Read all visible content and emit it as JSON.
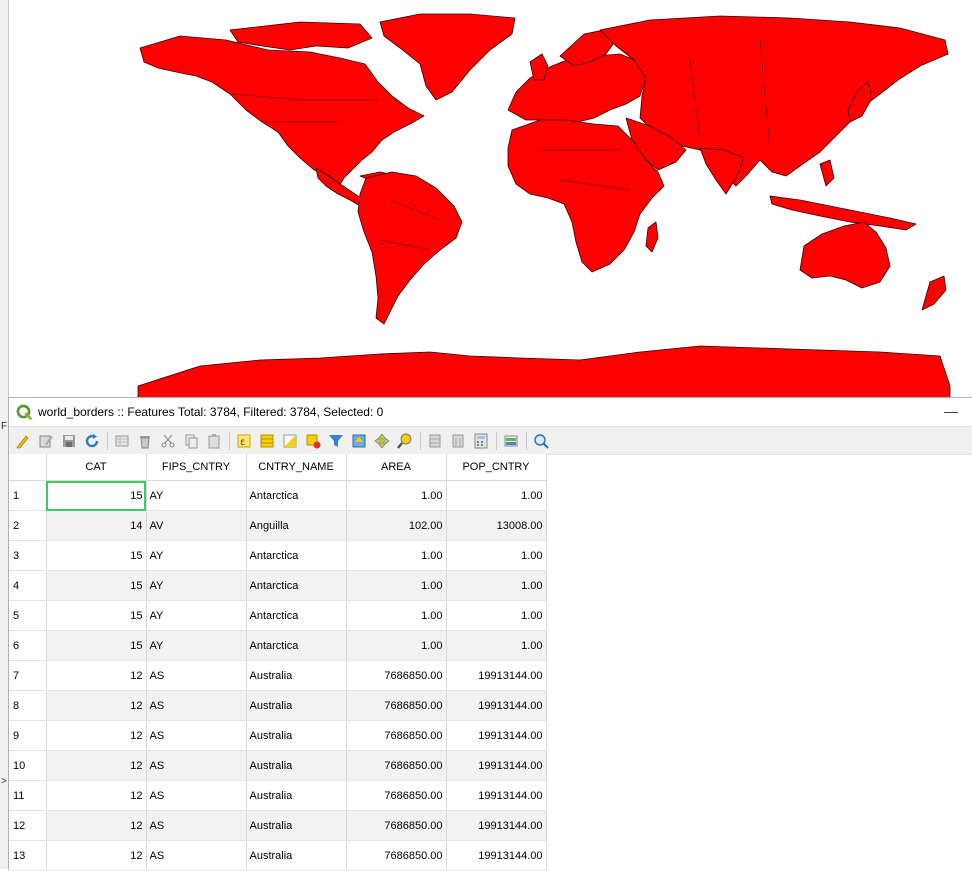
{
  "left_strip": {
    "partial_f": "F",
    "partial_gt": ">"
  },
  "map": {
    "fill_color": "#ff0000",
    "stroke_color": "#330000"
  },
  "attribute_table": {
    "title": "world_borders :: Features Total: 3784, Filtered: 3784, Selected: 0",
    "minimize_glyph": "—",
    "toolbar_icons": [
      "toggle-editing-icon",
      "multi-edit-icon",
      "save-edits-icon",
      "reload-icon",
      "add-feature-icon",
      "delete-feature-icon",
      "cut-icon",
      "copy-icon",
      "paste-icon",
      "select-by-expression-icon",
      "select-all-icon",
      "invert-selection-icon",
      "deselect-all-icon",
      "filter-icon",
      "move-selection-to-top-icon",
      "pan-to-selection-icon",
      "zoom-to-selection-icon",
      "new-field-icon",
      "delete-field-icon",
      "field-calculator-icon",
      "conditional-formatting-icon",
      "actions-icon"
    ],
    "columns": [
      "CAT",
      "FIPS_CNTRY",
      "CNTRY_NAME",
      "AREA",
      "POP_CNTRY"
    ],
    "rows": [
      {
        "n": "1",
        "cat": "15",
        "fips": "AY",
        "name": "Antarctica",
        "area": "1.00",
        "pop": "1.00"
      },
      {
        "n": "2",
        "cat": "14",
        "fips": "AV",
        "name": "Anguilla",
        "area": "102.00",
        "pop": "13008.00"
      },
      {
        "n": "3",
        "cat": "15",
        "fips": "AY",
        "name": "Antarctica",
        "area": "1.00",
        "pop": "1.00"
      },
      {
        "n": "4",
        "cat": "15",
        "fips": "AY",
        "name": "Antarctica",
        "area": "1.00",
        "pop": "1.00"
      },
      {
        "n": "5",
        "cat": "15",
        "fips": "AY",
        "name": "Antarctica",
        "area": "1.00",
        "pop": "1.00"
      },
      {
        "n": "6",
        "cat": "15",
        "fips": "AY",
        "name": "Antarctica",
        "area": "1.00",
        "pop": "1.00"
      },
      {
        "n": "7",
        "cat": "12",
        "fips": "AS",
        "name": "Australia",
        "area": "7686850.00",
        "pop": "19913144.00"
      },
      {
        "n": "8",
        "cat": "12",
        "fips": "AS",
        "name": "Australia",
        "area": "7686850.00",
        "pop": "19913144.00"
      },
      {
        "n": "9",
        "cat": "12",
        "fips": "AS",
        "name": "Australia",
        "area": "7686850.00",
        "pop": "19913144.00"
      },
      {
        "n": "10",
        "cat": "12",
        "fips": "AS",
        "name": "Australia",
        "area": "7686850.00",
        "pop": "19913144.00"
      },
      {
        "n": "11",
        "cat": "12",
        "fips": "AS",
        "name": "Australia",
        "area": "7686850.00",
        "pop": "19913144.00"
      },
      {
        "n": "12",
        "cat": "12",
        "fips": "AS",
        "name": "Australia",
        "area": "7686850.00",
        "pop": "19913144.00"
      },
      {
        "n": "13",
        "cat": "12",
        "fips": "AS",
        "name": "Australia",
        "area": "7686850.00",
        "pop": "19913144.00"
      }
    ]
  }
}
